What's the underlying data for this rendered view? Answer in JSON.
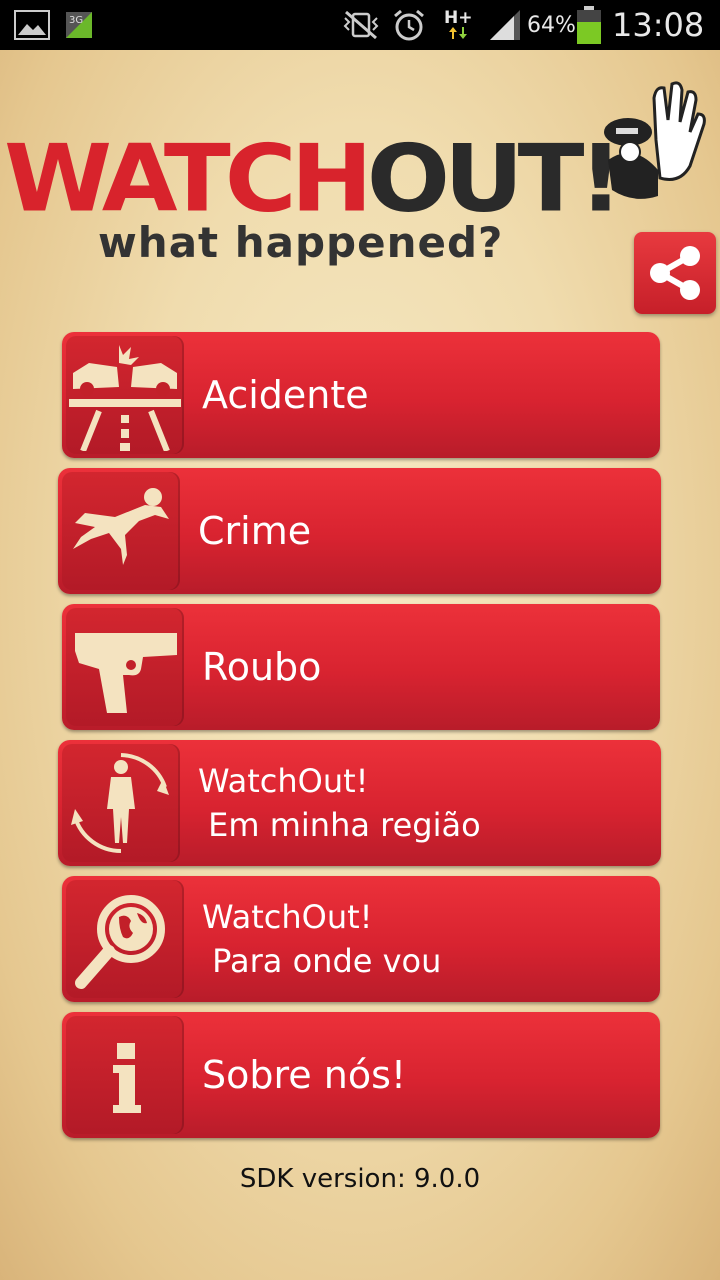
{
  "status_bar": {
    "network_badge": "3G",
    "network_type": "H+",
    "battery_percent": "64%",
    "time": "13:08"
  },
  "logo": {
    "main_red": "WATCH",
    "main_black": "OUT!",
    "subtitle": "what happened?"
  },
  "menu": [
    {
      "label": "Acidente",
      "icon": "car-crash-icon"
    },
    {
      "label": "Crime",
      "icon": "victim-icon"
    },
    {
      "label": "Roubo",
      "icon": "pistol-icon"
    },
    {
      "label": "WatchOut!\n Em minha região",
      "icon": "person-region-icon"
    },
    {
      "label": "WatchOut!\n Para onde vou",
      "icon": "globe-search-icon"
    },
    {
      "label": "Sobre nós!",
      "icon": "info-icon"
    }
  ],
  "footer": {
    "sdk_version": "SDK version: 9.0.0"
  },
  "colors": {
    "button_red": "#d82330",
    "icon_cream": "#f4e3c0",
    "background": "#f0dcae"
  }
}
